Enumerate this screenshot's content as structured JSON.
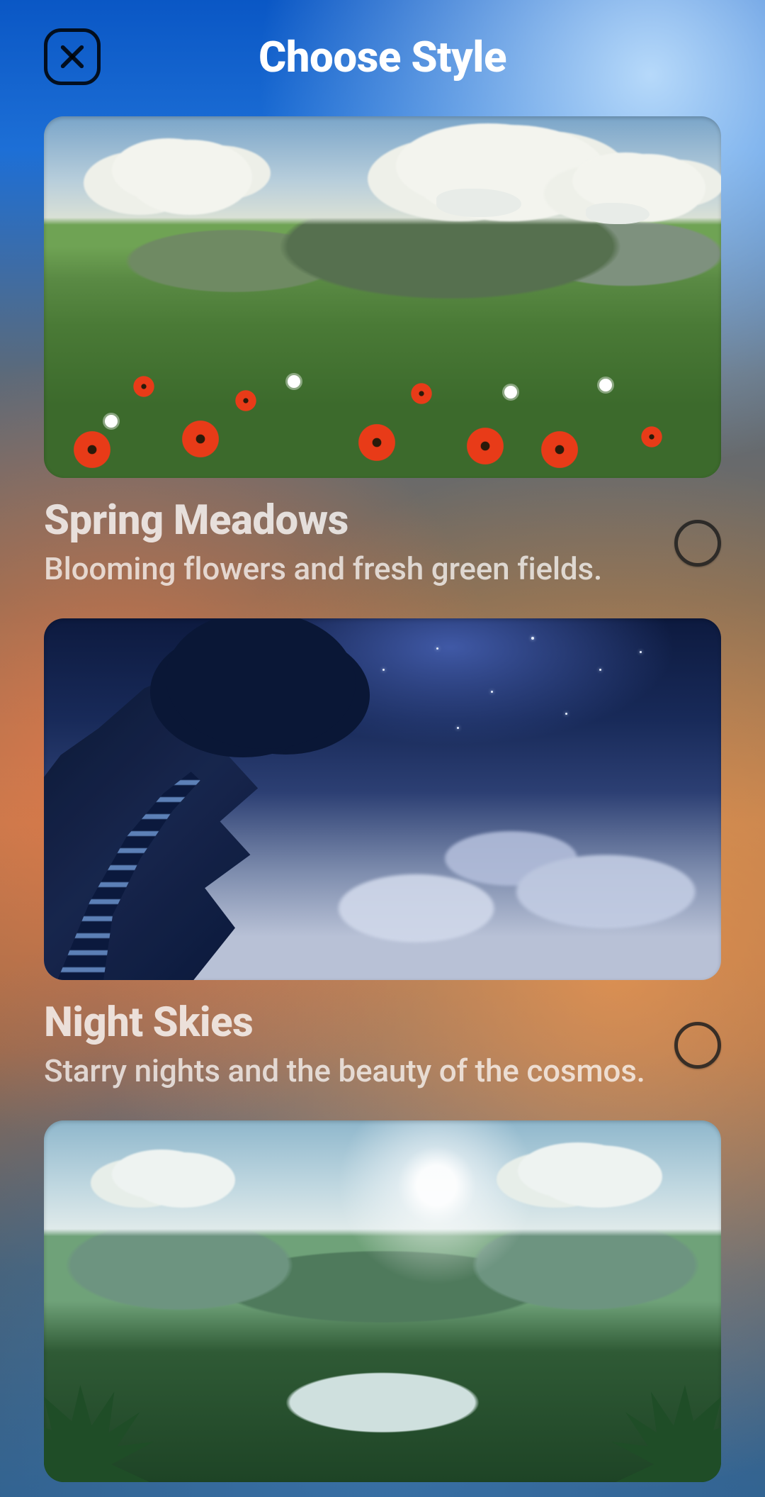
{
  "header": {
    "title": "Choose Style"
  },
  "styles": [
    {
      "title": "Spring Meadows",
      "description": "Blooming flowers and fresh green fields.",
      "selected": false
    },
    {
      "title": "Night Skies",
      "description": "Starry nights and the beauty of the cosmos.",
      "selected": false
    }
  ]
}
